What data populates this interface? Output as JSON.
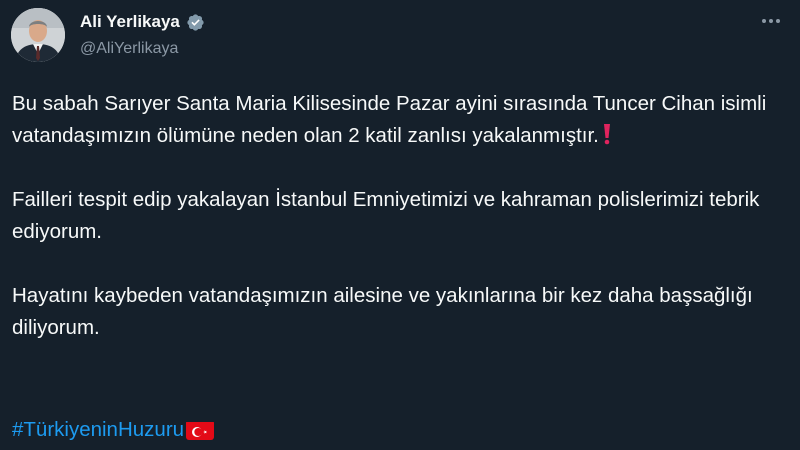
{
  "author": {
    "display_name": "Ali Yerlikaya",
    "handle": "@AliYerlikaya",
    "verified": true
  },
  "icons": {
    "more": "more-dots-icon",
    "verified": "verified-badge-icon",
    "emphasis": "red-exclamation-icon",
    "flag": "turkey-flag-icon"
  },
  "colors": {
    "background": "#15202b",
    "text": "#f7f9f9",
    "muted": "#8b98a5",
    "link": "#1d9bf0",
    "verified_badge": "#829aab",
    "exclamation": "#e0245e"
  },
  "tweet": {
    "paragraph1": "Bu sabah Sarıyer Santa Maria Kilisesinde Pazar ayini sırasında Tuncer Cihan isimli vatandaşımızın ölümüne neden olan 2 katil zanlısı yakalanmıştır.",
    "paragraph2": "Failleri tespit edip yakalayan İstanbul Emniyetimizi ve kahraman polislerimizi tebrik ediyorum.",
    "paragraph3": "Hayatını kaybeden vatandaşımızın ailesine ve yakınlarına bir kez daha başsağlığı diliyorum.",
    "hashtag": "#TürkiyeninHuzuru"
  }
}
